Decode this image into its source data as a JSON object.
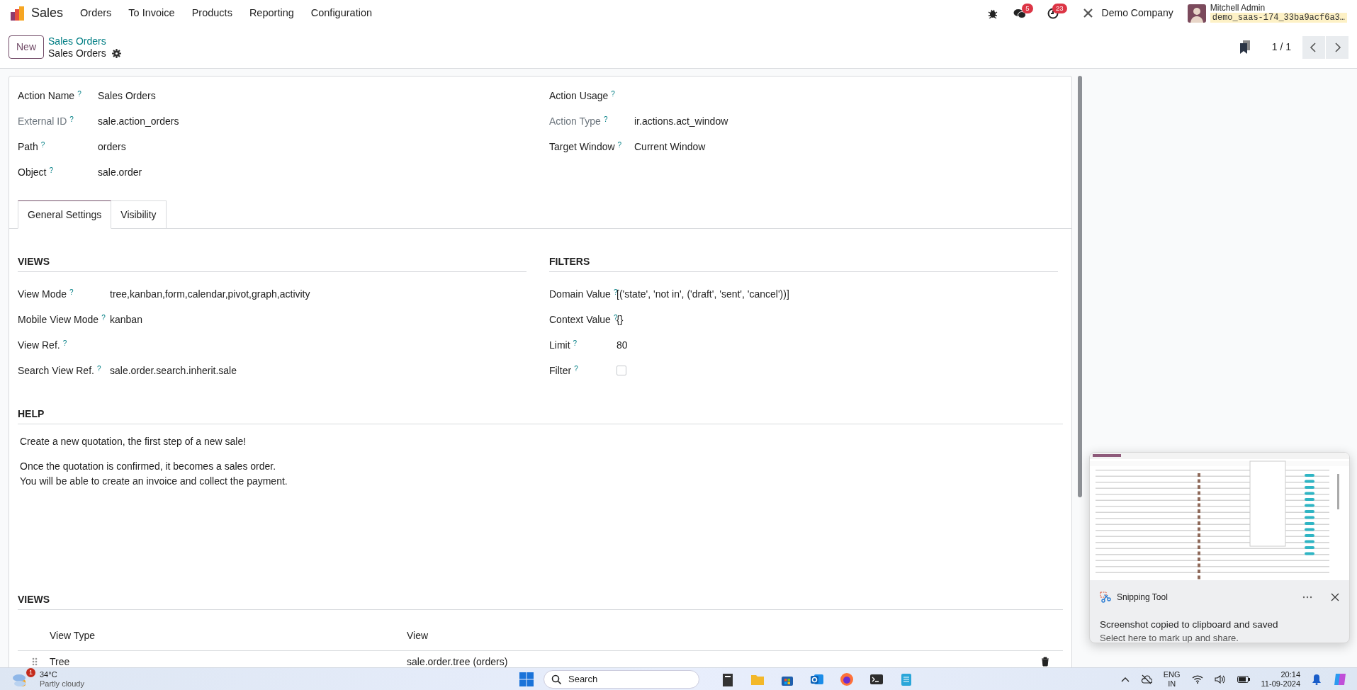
{
  "navbar": {
    "app": "Sales",
    "menus": [
      "Orders",
      "To Invoice",
      "Products",
      "Reporting",
      "Configuration"
    ],
    "messages_count": "5",
    "activities_count": "23",
    "company": "Demo Company",
    "user": "Mitchell Admin",
    "database": "demo_saas-174_33ba9acf6a3…"
  },
  "control_panel": {
    "new_button": "New",
    "breadcrumb": "Sales Orders",
    "title": "Sales Orders",
    "pager": "1 / 1"
  },
  "form": {
    "fields_left": [
      {
        "label": "Action Name",
        "help_mark": "?",
        "value": "Sales Orders",
        "muted": false,
        "kind": "text"
      },
      {
        "label": "External ID",
        "help_mark": "?",
        "value": "sale.action_orders",
        "muted": true,
        "kind": "text"
      },
      {
        "label": "Path",
        "help_mark": "?",
        "value": "orders",
        "muted": false,
        "kind": "text"
      },
      {
        "label": "Object",
        "help_mark": "?",
        "value": "sale.order",
        "muted": false,
        "kind": "text"
      }
    ],
    "fields_right": [
      {
        "label": "Action Usage",
        "help_mark": "?",
        "muted": false,
        "kind": "text"
      },
      {
        "label": "Action Type",
        "help_mark": "?",
        "value": "ir.actions.act_window",
        "muted": true,
        "kind": "text"
      },
      {
        "label": "Target Window",
        "help_mark": "?",
        "value": "Current Window",
        "muted": false,
        "kind": "text"
      }
    ],
    "tabs": [
      {
        "label": "General Settings",
        "selected": true
      },
      {
        "label": "Visibility",
        "selected": false
      }
    ],
    "views_section": {
      "title": "VIEWS",
      "fields": [
        {
          "label": "View Mode",
          "help_mark": "?",
          "value": "tree,kanban,form,calendar,pivot,graph,activity",
          "kind": "text"
        },
        {
          "label": "Mobile View Mode",
          "help_mark": "?",
          "value": "kanban",
          "kind": "text"
        },
        {
          "label": "View Ref.",
          "help_mark": "?",
          "kind": "text"
        },
        {
          "label": "Search View Ref.",
          "help_mark": "?",
          "value": "sale.order.search.inherit.sale",
          "kind": "text"
        }
      ]
    },
    "filters_section": {
      "title": "FILTERS",
      "fields": [
        {
          "label": "Domain Value",
          "help_mark": "?",
          "value": "[('state', 'not in', ('draft', 'sent', 'cancel'))]",
          "kind": "text"
        },
        {
          "label": "Context Value",
          "help_mark": "?",
          "value": "{}",
          "kind": "text"
        },
        {
          "label": "Limit",
          "help_mark": "?",
          "value": "80",
          "kind": "text"
        },
        {
          "label": "Filter",
          "help_mark": "?",
          "checked": false,
          "kind": "checkbox"
        }
      ]
    },
    "help": {
      "title": "HELP",
      "paragraphs": [
        [
          "Create a new quotation, the first step of a new sale!"
        ],
        [
          "Once the quotation is confirmed, it becomes a sales order.",
          "You will be able to create an invoice and collect the payment."
        ]
      ]
    },
    "views_table": {
      "title": "VIEWS",
      "columns": [
        "View Type",
        "View"
      ],
      "rows": [
        {
          "view_type": "Tree",
          "view": "sale.order.tree (orders)"
        }
      ]
    }
  },
  "notification": {
    "app": "Snipping Tool",
    "title": "Screenshot copied to clipboard and saved",
    "body": "Select here to mark up and share."
  },
  "taskbar": {
    "weather_badge": "1",
    "temperature": "34°C",
    "weather": "Partly cloudy",
    "search": "Search",
    "language": [
      "ENG",
      "IN"
    ],
    "time": "20:14",
    "date": "11-09-2024"
  }
}
